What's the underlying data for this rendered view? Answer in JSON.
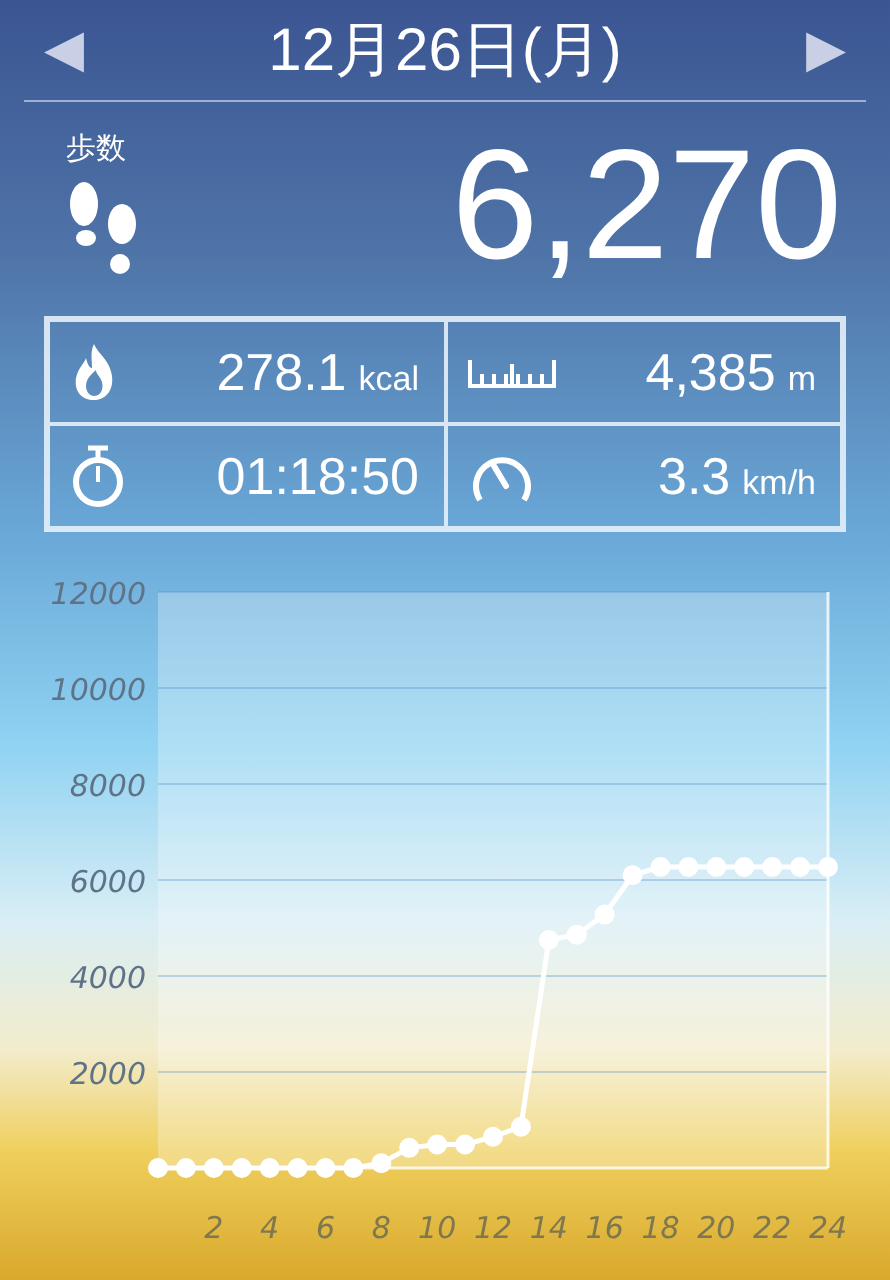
{
  "header": {
    "date": "12月26日(月)",
    "prev": "◀",
    "next": "▶"
  },
  "steps": {
    "label": "歩数",
    "value": "6,270"
  },
  "stats": [
    {
      "kind": "calories",
      "value": "278.1",
      "unit": "kcal"
    },
    {
      "kind": "distance",
      "value": "4,385",
      "unit": "m"
    },
    {
      "kind": "time",
      "value": "01:18:50"
    },
    {
      "kind": "speed",
      "value": "3.3",
      "unit": "km/h"
    }
  ],
  "chart": {
    "chart_data": {
      "type": "line",
      "x": [
        0,
        1,
        2,
        3,
        4,
        5,
        6,
        7,
        8,
        9,
        10,
        11,
        12,
        13,
        14,
        15,
        16,
        17,
        18,
        19,
        20,
        21,
        22,
        23,
        24
      ],
      "grid": true,
      "series": [
        {
          "color": "#ffffff",
          "marker": true,
          "values": [
            0,
            0,
            0,
            0,
            0,
            0,
            0,
            0,
            100,
            420,
            490,
            490,
            650,
            860,
            4750,
            4860,
            5280,
            6100,
            6270,
            6270,
            6270,
            6270,
            6270,
            6270,
            6270
          ]
        }
      ],
      "xlim": [
        0,
        24
      ],
      "ylim": [
        0,
        12000
      ],
      "xticks": [
        2,
        4,
        6,
        8,
        10,
        12,
        14,
        16,
        18,
        20,
        22,
        24
      ],
      "yticks": [
        2000,
        4000,
        6000,
        8000,
        10000,
        12000
      ]
    }
  }
}
